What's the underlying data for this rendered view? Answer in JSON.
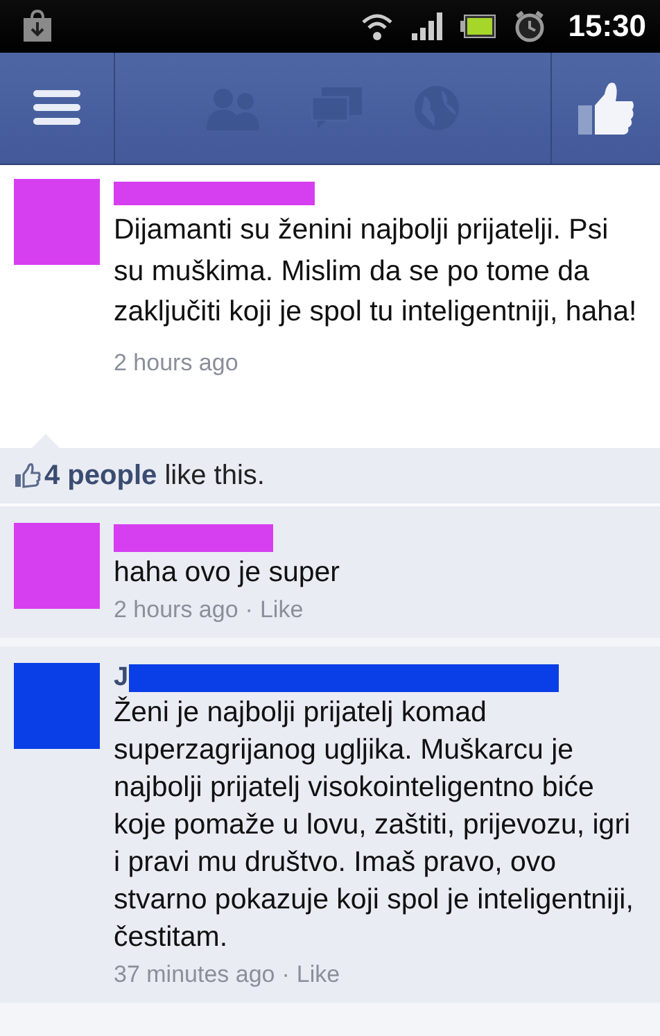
{
  "status_bar": {
    "time": "15:30"
  },
  "post": {
    "color": "#d63ff0",
    "text": "Dijamanti su ženini najbolji prijatelji. Psi su muškima. Mislim da se po tome da zaključiti koji je spol tu inteligentniji, haha!",
    "time": "2 hours ago"
  },
  "likes": {
    "text": "**4 people** like this."
  },
  "comments": [
    {
      "color": "#d63ff0",
      "text": "haha ovo je super",
      "time": "2 hours ago",
      "separator": "·",
      "action": "Like"
    },
    {
      "color": "#0a3ee6",
      "name": "J",
      "text": "Ženi je najbolji prijatelj komad superzagrijanog ugljika. Muškarcu je najbolji prijatelj visokointeligentno biće koje pomaže u lovu, zaštiti, prijevozu, igri i pravi mu društvo. Imaš pravo, ovo stvarno pokazuje koji spol je inteligentniji, čestitam.",
      "time": "37 minutes ago",
      "separator": "·",
      "action": "Like"
    }
  ]
}
